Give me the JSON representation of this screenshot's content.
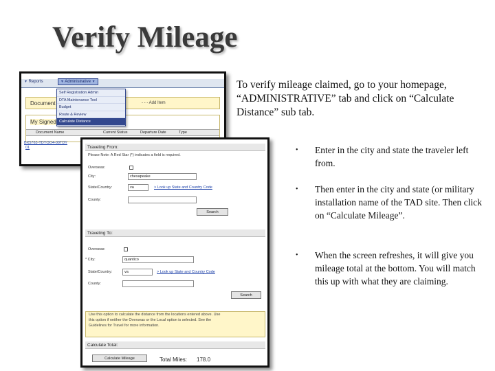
{
  "slide": {
    "title": "Verify Mileage",
    "intro": "To verify mileage claimed, go to your homepage, “ADMINISTRATIVE” tab and click on “Calculate Distance” sub tab.",
    "bullets": [
      "Enter in the city and state the traveler left from.",
      "Then enter in the city and state (or military installation name of the TAD site.  Then click on “Calculate Mileage”.",
      "When the screen refreshes, it will give you mileage total at the bottom.  You will match this up with what they are claiming."
    ],
    "bullet_glyph": "•"
  },
  "shot1": {
    "nav_reports": "Reports",
    "nav_admin": "Administrative",
    "nav_arrow": "▼",
    "documents_label": "Document",
    "documents_right": "- - -   Add  Item",
    "signed_title": "My Signed",
    "signed_columns": [
      "Document Name",
      "Current Status",
      "Departure Date",
      "Type"
    ],
    "row_link": "BX5763-TDYOO4-00TDY",
    "row_link2": "01",
    "dropdown_items": [
      "Self Registration Admin",
      "DTA Maintenance Tool",
      "Budget",
      "Route & Review",
      "Calculate Distance"
    ]
  },
  "shot2": {
    "from_head": "Traveling From:",
    "from_note": "Please Note: A Red Star (*) indicates a field is required.",
    "from_labels": [
      "Overseas:",
      "City:",
      "State/Country:",
      "County:"
    ],
    "from_city": "chesapeake",
    "from_state": "va",
    "from_lookup": "> Look up State and Country Code",
    "from_search": "Search",
    "to_head": "Traveling To:",
    "to_labels": [
      "Overseas:",
      "* City:",
      "State/Country:",
      "County:"
    ],
    "to_city": "quantico",
    "to_state": "va",
    "to_lookup": "> Look up State and Country Code",
    "to_search": "Search",
    "note_lines": [
      "Use this option to calculate the distance from the locations entered above. Use",
      "this option if neither the Overseas or the Local option is selected. See the",
      "Guidelines for Travel for more information."
    ],
    "calc_head": "Calculate Total:",
    "calc_button": "Calculate Mileage",
    "total_label": "Total Miles:",
    "total_value": "178.0"
  }
}
